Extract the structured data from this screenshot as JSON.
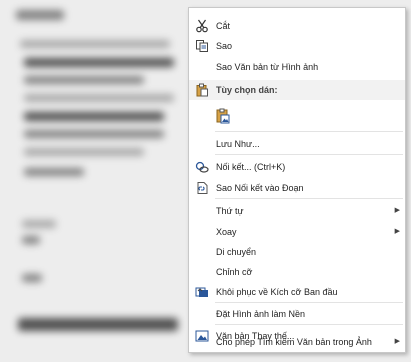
{
  "menu": {
    "items": [
      {
        "id": "cut",
        "label": "Cắt",
        "icon": "scissors-icon"
      },
      {
        "id": "copy",
        "label": "Sao",
        "icon": "copy-icon"
      },
      {
        "id": "copy-text",
        "label": "Sao Văn bản từ Hình ảnh",
        "icon": ""
      },
      {
        "id": "paste-options-header",
        "label": "Tùy chọn dán:",
        "icon": "clipboard-icon"
      },
      {
        "id": "paste-picture",
        "label": "",
        "icon": "paste-picture-icon"
      },
      {
        "id": "save-as",
        "label": "Lưu Như...",
        "icon": ""
      },
      {
        "id": "link",
        "label": "Nối kết...  (Ctrl+K)",
        "icon": "link-icon"
      },
      {
        "id": "copy-link-to-paragraph",
        "label": "Sao Nối kết vào Đoạn",
        "icon": "link-paragraph-icon"
      },
      {
        "id": "order",
        "label": "Thứ tự",
        "icon": "",
        "submenu": true
      },
      {
        "id": "rotate",
        "label": "Xoay",
        "icon": "",
        "submenu": true
      },
      {
        "id": "move",
        "label": "Di chuyển",
        "icon": ""
      },
      {
        "id": "resize",
        "label": "Chỉnh cỡ",
        "icon": ""
      },
      {
        "id": "reset-size",
        "label": "Khôi phục về Kích cỡ Ban đầu",
        "icon": "reset-size-icon"
      },
      {
        "id": "set-background",
        "label": "Đặt Hình ảnh làm Nền",
        "icon": ""
      },
      {
        "id": "alt-text",
        "label": "Văn bản Thay thế...",
        "icon": "alt-text-icon"
      },
      {
        "id": "allow-search",
        "label": "Cho phép Tìm kiếm Văn bản trong Ảnh",
        "icon": "",
        "submenu": true
      }
    ]
  },
  "colors": {
    "accent": "#2b579a",
    "clipboard": "#d7a246"
  }
}
